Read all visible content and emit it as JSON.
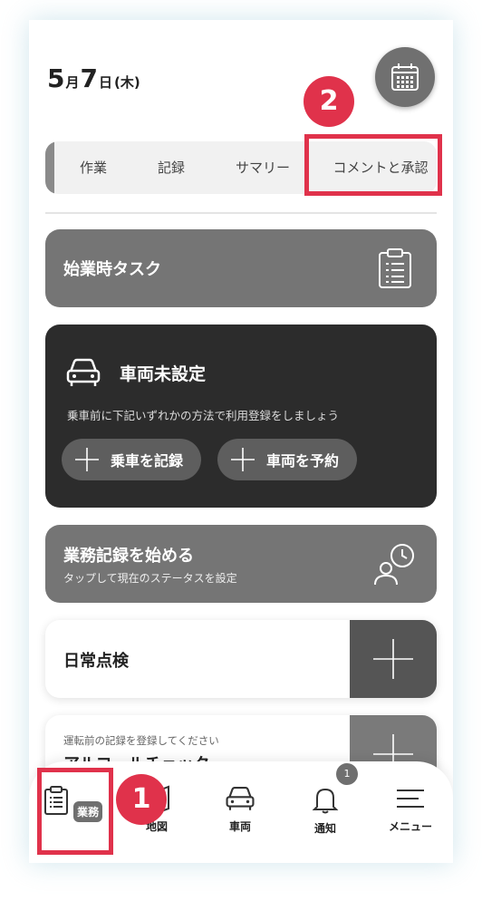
{
  "header": {
    "month": "5",
    "month_unit": "月",
    "day": "7",
    "day_unit": "日",
    "weekday": "(木)"
  },
  "tabs": [
    {
      "label": "作業"
    },
    {
      "label": "記録"
    },
    {
      "label": "サマリー"
    },
    {
      "label": "コメントと承認"
    }
  ],
  "start_task": {
    "label": "始業時タスク"
  },
  "vehicle": {
    "title": "車両未設定",
    "description": "乗車前に下記いずれかの方法で利用登録をしましょう",
    "ride_label": "乗車を記録",
    "reserve_label": "車両を予約"
  },
  "work_record": {
    "title": "業務記録を始める",
    "subtitle": "タップして現在のステータスを設定"
  },
  "daily_check": {
    "label": "日常点検"
  },
  "alcohol_check": {
    "subtitle": "運転前の記録を登録してください",
    "title": "アルコールチェック"
  },
  "bottom_nav": {
    "work": "業務",
    "map": "地図",
    "vehicle": "車両",
    "notify": "通知",
    "notify_count": "1",
    "menu": "メニュー"
  },
  "callouts": {
    "one": "1",
    "two": "2"
  },
  "colors": {
    "highlight": "#e0324b",
    "card_gray": "#757575",
    "card_dark": "#2c2c2c"
  }
}
